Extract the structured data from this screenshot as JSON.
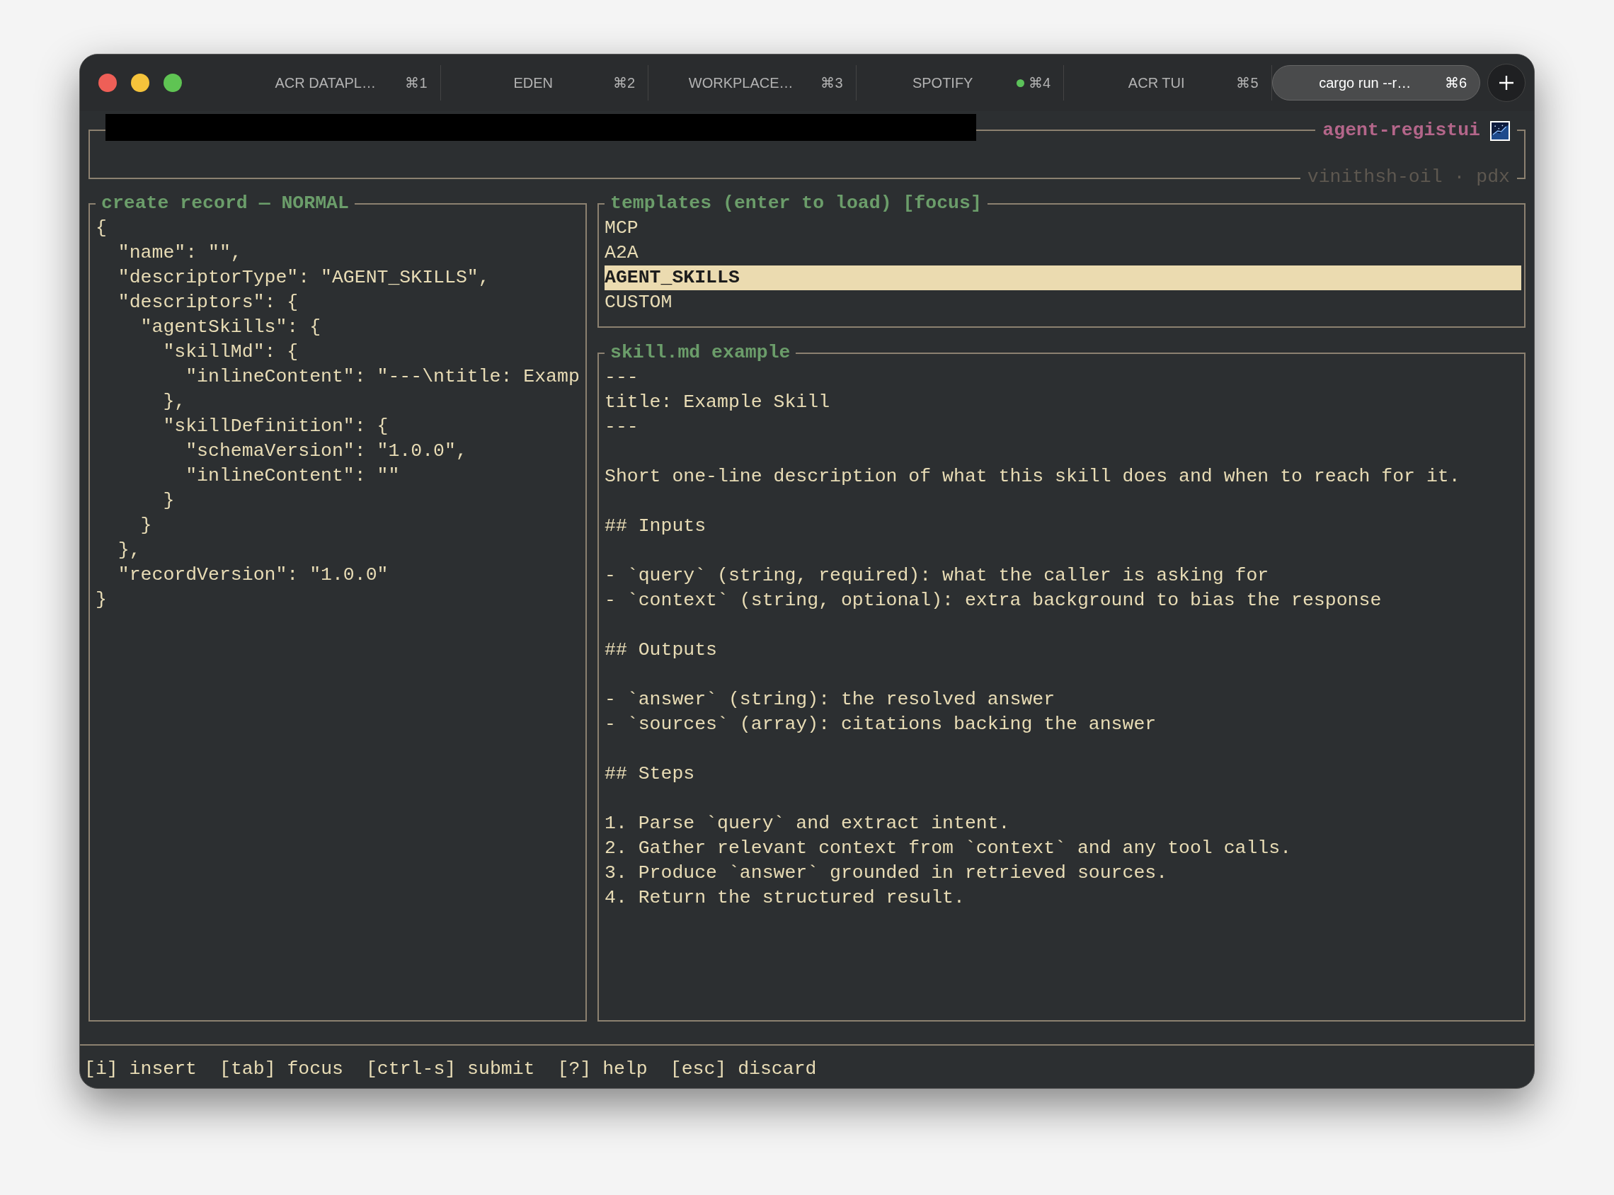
{
  "tabs": [
    {
      "label": "ACR DATAPL…",
      "shortcut": "⌘1",
      "selected": false,
      "activity": false
    },
    {
      "label": "EDEN",
      "shortcut": "⌘2",
      "selected": false,
      "activity": false
    },
    {
      "label": "WORKPLACE…",
      "shortcut": "⌘3",
      "selected": false,
      "activity": false
    },
    {
      "label": "SPOTIFY",
      "shortcut": "⌘4",
      "selected": false,
      "activity": true
    },
    {
      "label": "ACR TUI",
      "shortcut": "⌘5",
      "selected": false,
      "activity": false
    },
    {
      "label": "cargo run --r…",
      "shortcut": "⌘6",
      "selected": true,
      "activity": false
    }
  ],
  "header": {
    "title": "agent-registui",
    "subtitle": "vinithsh-oil · pdx"
  },
  "editor": {
    "title": "create record — NORMAL",
    "lines": [
      "{",
      "  \"name\": \"\",",
      "  \"descriptorType\": \"AGENT_SKILLS\",",
      "  \"descriptors\": {",
      "    \"agentSkills\": {",
      "      \"skillMd\": {",
      "        \"inlineContent\": \"---\\ntitle: Examp",
      "      },",
      "      \"skillDefinition\": {",
      "        \"schemaVersion\": \"1.0.0\",",
      "        \"inlineContent\": \"\"",
      "      }",
      "    }",
      "  },",
      "  \"recordVersion\": \"1.0.0\"",
      "}"
    ]
  },
  "templates": {
    "title": "templates (enter to load) [focus]",
    "items": [
      {
        "label": "MCP",
        "selected": false
      },
      {
        "label": "A2A",
        "selected": false
      },
      {
        "label": "AGENT_SKILLS",
        "selected": true
      },
      {
        "label": "CUSTOM",
        "selected": false
      }
    ]
  },
  "preview": {
    "title": "skill.md example",
    "blocks": [
      [
        "---",
        "title: Example Skill",
        "---"
      ],
      [
        "Short one-line description of what this skill does and when to reach for it."
      ],
      [
        "## Inputs"
      ],
      [
        "- `query` (string, required): what the caller is asking for",
        "- `context` (string, optional): extra background to bias the response"
      ],
      [
        "## Outputs"
      ],
      [
        "- `answer` (string): the resolved answer",
        "- `sources` (array): citations backing the answer"
      ],
      [
        "## Steps"
      ],
      [
        "1. Parse `query` and extract intent.",
        "2. Gather relevant context from `context` and any tool calls.",
        "3. Produce `answer` grounded in retrieved sources.",
        "4. Return the structured result."
      ]
    ]
  },
  "footer": {
    "hints": [
      "[i] insert",
      "[tab] focus",
      "[ctrl-s] submit",
      "[?] help",
      "[esc] discard"
    ]
  }
}
